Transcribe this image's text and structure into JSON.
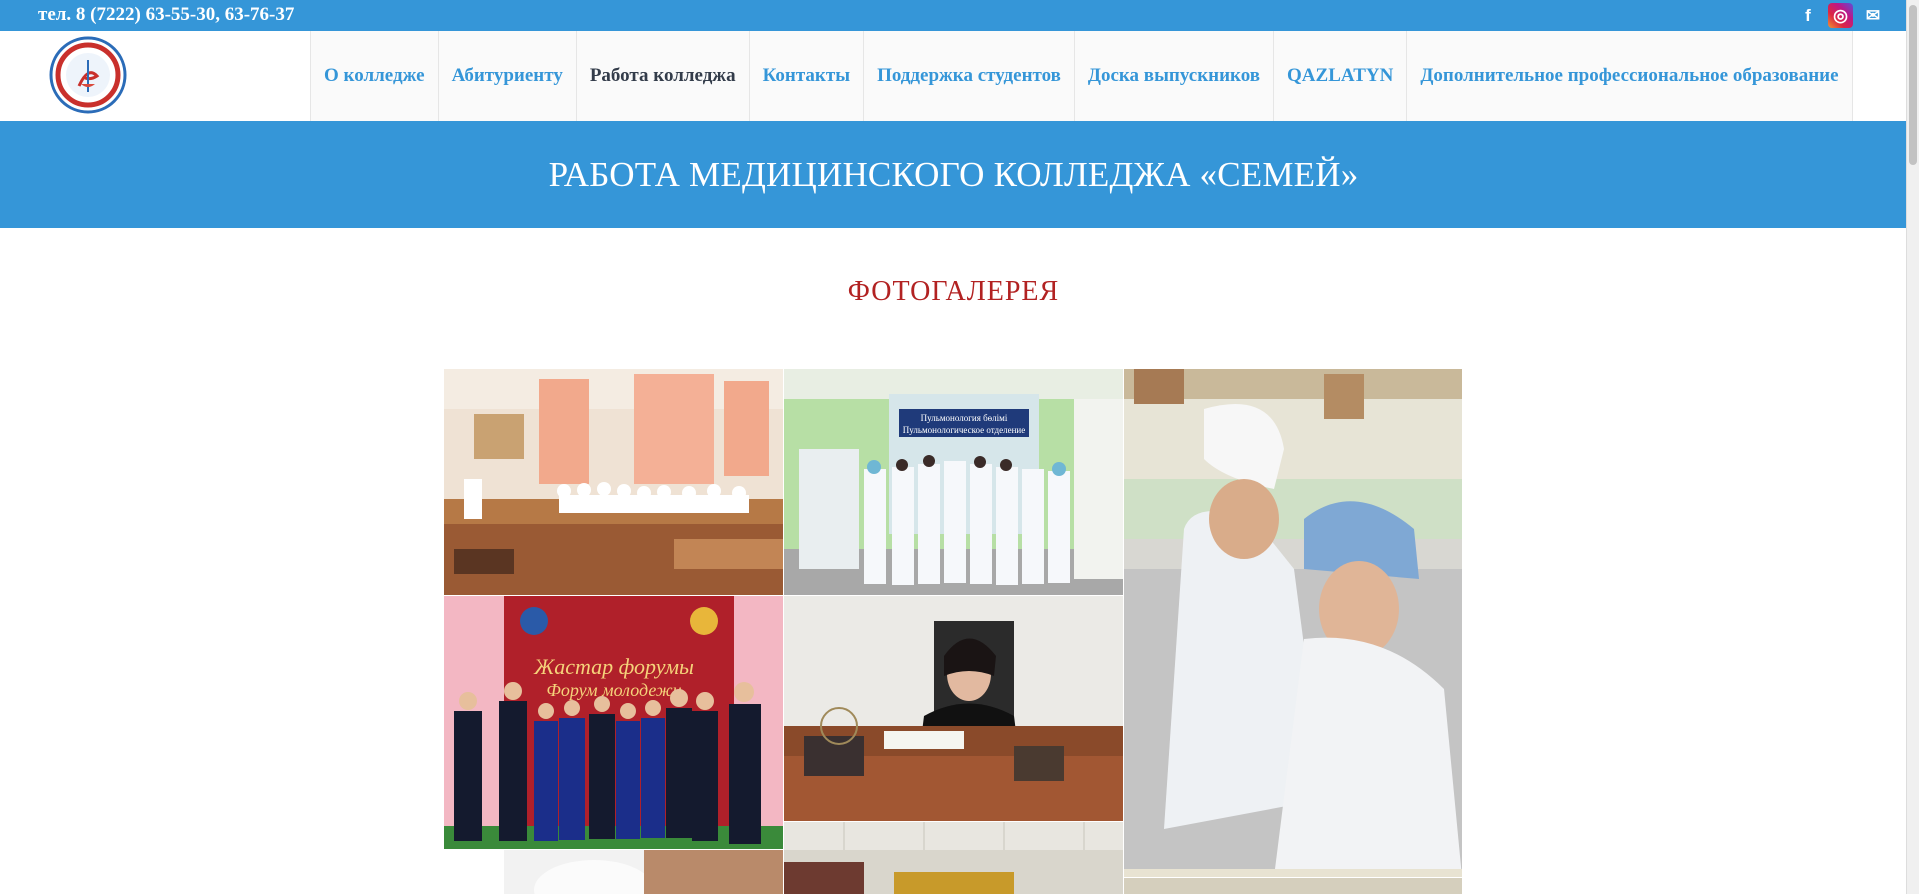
{
  "topbar": {
    "phone": "тел. 8 (7222) 63-55-30, 63-76-37",
    "social": [
      {
        "icon": "facebook-icon",
        "glyph": "f"
      },
      {
        "icon": "instagram-icon",
        "glyph": "◎"
      },
      {
        "icon": "mail-icon",
        "glyph": "✉"
      }
    ]
  },
  "nav": {
    "items": [
      {
        "label": "О колледже",
        "active": false
      },
      {
        "label": "Абитуриенту",
        "active": false
      },
      {
        "label": "Работа колледжа",
        "active": true
      },
      {
        "label": "Контакты",
        "active": false
      },
      {
        "label": "Поддержка студентов",
        "active": false
      },
      {
        "label": "Доска выпускников",
        "active": false
      },
      {
        "label": "QAZLATYN",
        "active": false
      },
      {
        "label": "Дополнительное профессиональное образование",
        "active": false
      }
    ]
  },
  "banner": {
    "title": "РАБОТА МЕДИЦИНСКОГО КОЛЛЕДЖА «СЕМЕЙ»"
  },
  "gallery": {
    "title": "ФОТОГАЛЕРЕЯ",
    "posters": [
      "Жастар форумы",
      "Форум молодежи",
      "Пульмонология бөлімі",
      "Пульмонологическое отделение"
    ]
  },
  "colors": {
    "brand": "#3596d8",
    "accent": "#b22222",
    "active_nav": "#333c4a"
  }
}
